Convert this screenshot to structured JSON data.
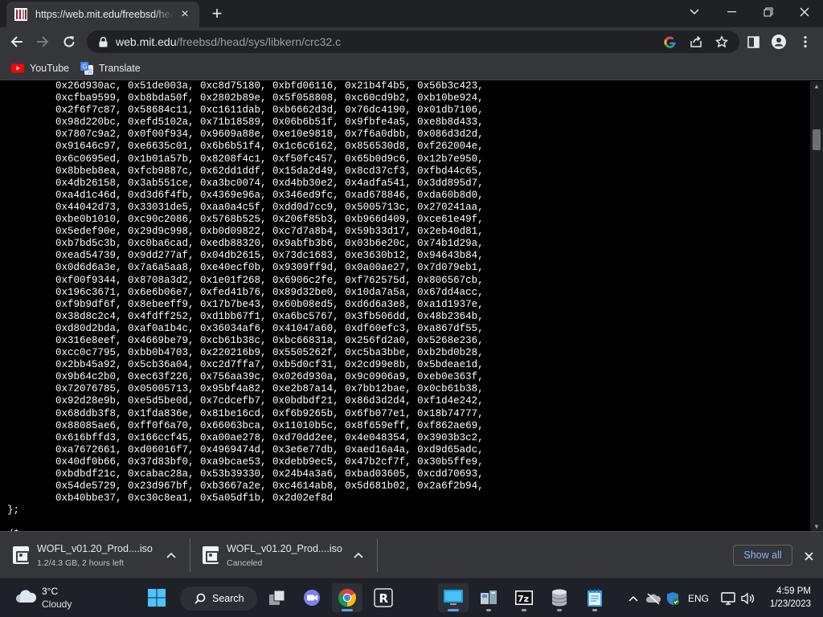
{
  "browser": {
    "tab": {
      "title": "https://web.mit.edu/freebsd/head/sys/libkern/crc32.c"
    },
    "address": {
      "host": "web.mit.edu",
      "path": "/freebsd/head/sys/libkern/crc32.c"
    },
    "bookmarks": [
      {
        "label": "YouTube",
        "icon": "youtube-icon"
      },
      {
        "label": "Translate",
        "icon": "translate-icon"
      }
    ]
  },
  "page": {
    "code_lines": [
      "        0x26d930ac, 0x51de003a, 0xc8d75180, 0xbfd06116, 0x21b4f4b5, 0x56b3c423,",
      "        0xcfba9599, 0xb8bda50f, 0x2802b89e, 0x5f058808, 0xc60cd9b2, 0xb10be924,",
      "        0x2f6f7c87, 0x58684c11, 0xc1611dab, 0xb6662d3d, 0x76dc4190, 0x01db7106,",
      "        0x98d220bc, 0xefd5102a, 0x71b18589, 0x06b6b51f, 0x9fbfe4a5, 0xe8b8d433,",
      "        0x7807c9a2, 0x0f00f934, 0x9609a88e, 0xe10e9818, 0x7f6a0dbb, 0x086d3d2d,",
      "        0x91646c97, 0xe6635c01, 0x6b6b51f4, 0x1c6c6162, 0x856530d8, 0xf262004e,",
      "        0x6c0695ed, 0x1b01a57b, 0x8208f4c1, 0xf50fc457, 0x65b0d9c6, 0x12b7e950,",
      "        0x8bbeb8ea, 0xfcb9887c, 0x62dd1ddf, 0x15da2d49, 0x8cd37cf3, 0xfbd44c65,",
      "        0x4db26158, 0x3ab551ce, 0xa3bc0074, 0xd4bb30e2, 0x4adfa541, 0x3dd895d7,",
      "        0xa4d1c46d, 0xd3d6f4fb, 0x4369e96a, 0x346ed9fc, 0xad678846, 0xda60b8d0,",
      "        0x44042d73, 0x33031de5, 0xaa0a4c5f, 0xdd0d7cc9, 0x5005713c, 0x270241aa,",
      "        0xbe0b1010, 0xc90c2086, 0x5768b525, 0x206f85b3, 0xb966d409, 0xce61e49f,",
      "        0x5edef90e, 0x29d9c998, 0xb0d09822, 0xc7d7a8b4, 0x59b33d17, 0x2eb40d81,",
      "        0xb7bd5c3b, 0xc0ba6cad, 0xedb88320, 0x9abfb3b6, 0x03b6e20c, 0x74b1d29a,",
      "        0xead54739, 0x9dd277af, 0x04db2615, 0x73dc1683, 0xe3630b12, 0x94643b84,",
      "        0x0d6d6a3e, 0x7a6a5aa8, 0xe40ecf0b, 0x9309ff9d, 0x0a00ae27, 0x7d079eb1,",
      "        0xf00f9344, 0x8708a3d2, 0x1e01f268, 0x6906c2fe, 0xf762575d, 0x806567cb,",
      "        0x196c3671, 0x6e6b06e7, 0xfed41b76, 0x89d32be0, 0x10da7a5a, 0x67dd4acc,",
      "        0xf9b9df6f, 0x8ebeeff9, 0x17b7be43, 0x60b08ed5, 0xd6d6a3e8, 0xa1d1937e,",
      "        0x38d8c2c4, 0x4fdff252, 0xd1bb67f1, 0xa6bc5767, 0x3fb506dd, 0x48b2364b,",
      "        0xd80d2bda, 0xaf0a1b4c, 0x36034af6, 0x41047a60, 0xdf60efc3, 0xa867df55,",
      "        0x316e8eef, 0x4669be79, 0xcb61b38c, 0xbc66831a, 0x256fd2a0, 0x5268e236,",
      "        0xcc0c7795, 0xbb0b4703, 0x220216b9, 0x5505262f, 0xc5ba3bbe, 0xb2bd0b28,",
      "        0x2bb45a92, 0x5cb36a04, 0xc2d7ffa7, 0xb5d0cf31, 0x2cd99e8b, 0x5bdeae1d,",
      "        0x9b64c2b0, 0xec63f226, 0x756aa39c, 0x026d930a, 0x9c0906a9, 0xeb0e363f,",
      "        0x72076785, 0x05005713, 0x95bf4a82, 0xe2b87a14, 0x7bb12bae, 0x0cb61b38,",
      "        0x92d28e9b, 0xe5d5be0d, 0x7cdcefb7, 0x0bdbdf21, 0x86d3d2d4, 0xf1d4e242,",
      "        0x68ddb3f8, 0x1fda836e, 0x81be16cd, 0xf6b9265b, 0x6fb077e1, 0x18b74777,",
      "        0x88085ae6, 0xff0f6a70, 0x66063bca, 0x11010b5c, 0x8f659eff, 0xf862ae69,",
      "        0x616bffd3, 0x166ccf45, 0xa00ae278, 0xd70dd2ee, 0x4e048354, 0x3903b3c2,",
      "        0xa7672661, 0xd06016f7, 0x4969474d, 0x3e6e77db, 0xaed16a4a, 0xd9d65adc,",
      "        0x40df0b66, 0x37d83bf0, 0xa9bcae53, 0xdebb9ec5, 0x47b2cf7f, 0x30b5ffe9,",
      "        0xbdbdf21c, 0xcabac28a, 0x53b39330, 0x24b4a3a6, 0xbad03605, 0xcdd70693,",
      "        0x54de5729, 0x23d967bf, 0xb3667a2e, 0xc4614ab8, 0x5d681b02, 0x2a6f2b94,",
      "        0xb40bbe37, 0xc30c8ea1, 0x5a05df1b, 0x2d02ef8d",
      "};",
      "",
      "/*"
    ]
  },
  "downloads": {
    "items": [
      {
        "name": "WOFL_v01.20_Prod....iso",
        "status": "1.2/4.3 GB, 2 hours left",
        "icon": "iso-file-icon"
      },
      {
        "name": "WOFL_v01.20_Prod....iso",
        "status": "Canceled",
        "icon": "iso-file-icon"
      }
    ],
    "show_all": "Show all"
  },
  "taskbar": {
    "weather": {
      "temp": "3°C",
      "condition": "Cloudy"
    },
    "search_label": "Search",
    "language": "ENG",
    "time": "4:59 PM",
    "date": "1/23/2023"
  },
  "colors": {
    "accent": "#8ab4f8",
    "youtube": "#ff0000",
    "mit_red": "#a31f34",
    "taskbar": "#1f2128"
  }
}
